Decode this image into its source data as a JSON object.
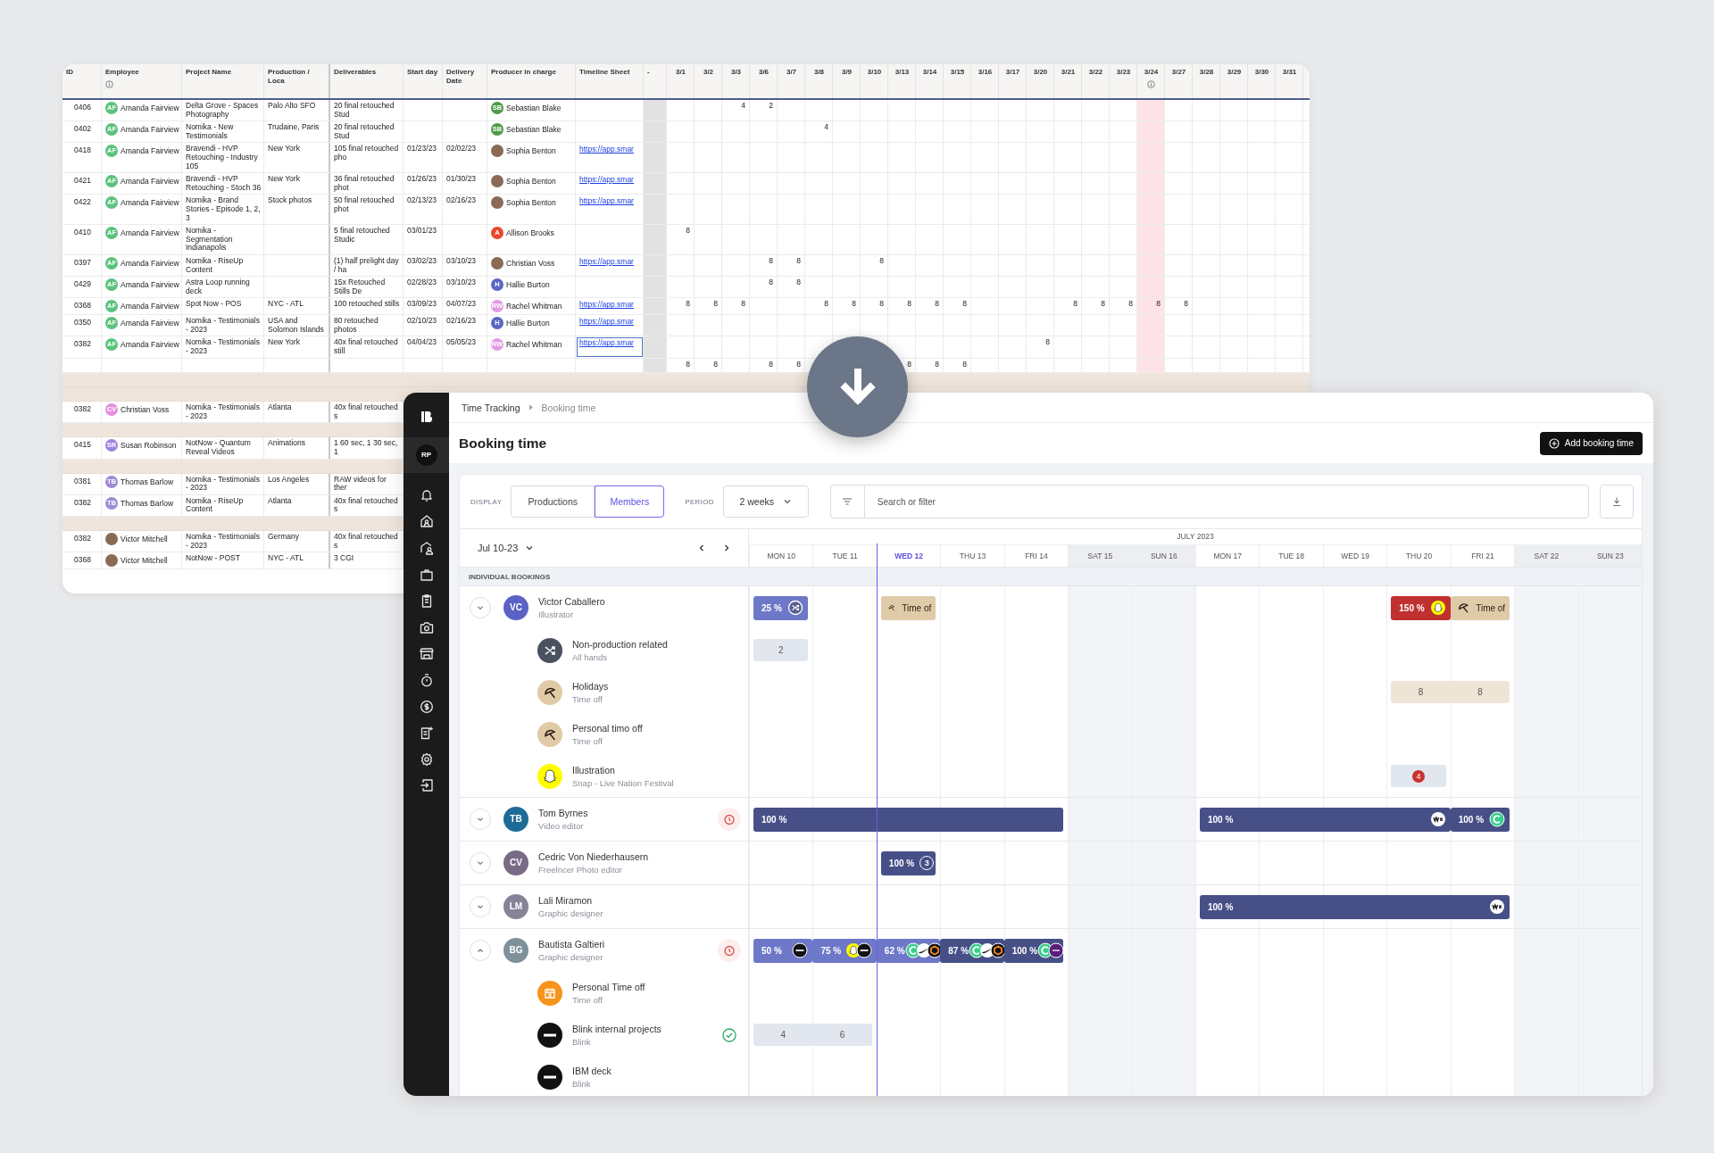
{
  "sheet": {
    "columns": [
      {
        "label": "ID",
        "info": false
      },
      {
        "label": "Employee",
        "info": true
      },
      {
        "label": "Project Name",
        "info": false
      },
      {
        "label": "Production / Loca",
        "info": false
      },
      {
        "label": "Deliverables",
        "info": false
      },
      {
        "label": "Start day",
        "info": false
      },
      {
        "label": "Delivery Date",
        "info": false
      },
      {
        "label": "Producer in charge",
        "info": false
      },
      {
        "label": "Timeline Sheet",
        "info": false
      },
      {
        "label": "-",
        "info": false
      }
    ],
    "days": [
      {
        "label": "3/1",
        "info": false,
        "highlighted": false
      },
      {
        "label": "3/2",
        "info": false,
        "highlighted": false
      },
      {
        "label": "3/3",
        "info": false,
        "highlighted": false
      },
      {
        "label": "3/6",
        "info": false,
        "highlighted": false
      },
      {
        "label": "3/7",
        "info": false,
        "highlighted": false
      },
      {
        "label": "3/8",
        "info": false,
        "highlighted": false
      },
      {
        "label": "3/9",
        "info": false,
        "highlighted": false
      },
      {
        "label": "3/10",
        "info": false,
        "highlighted": false
      },
      {
        "label": "3/13",
        "info": false,
        "highlighted": false
      },
      {
        "label": "3/14",
        "info": false,
        "highlighted": false
      },
      {
        "label": "3/15",
        "info": false,
        "highlighted": false
      },
      {
        "label": "3/16",
        "info": false,
        "highlighted": false
      },
      {
        "label": "3/17",
        "info": false,
        "highlighted": false
      },
      {
        "label": "3/20",
        "info": false,
        "highlighted": false
      },
      {
        "label": "3/21",
        "info": false,
        "highlighted": false
      },
      {
        "label": "3/22",
        "info": false,
        "highlighted": false
      },
      {
        "label": "3/23",
        "info": false,
        "highlighted": false
      },
      {
        "label": "3/24",
        "info": true,
        "highlighted": true
      },
      {
        "label": "3/27",
        "info": false,
        "highlighted": false
      },
      {
        "label": "3/28",
        "info": false,
        "highlighted": false
      },
      {
        "label": "3/29",
        "info": false,
        "highlighted": false
      },
      {
        "label": "3/30",
        "info": false,
        "highlighted": false
      },
      {
        "label": "3/31",
        "info": false,
        "highlighted": false
      }
    ],
    "rows": [
      {
        "kind": "entry",
        "id": "0406",
        "employee": {
          "name": "Amanda Fairview",
          "avatar": {
            "kind": "initials",
            "initials": "AF",
            "color": "#5cc27e"
          }
        },
        "project": "Delta Grove - Spaces Photography",
        "location": "Palo Alto SFO",
        "deliverables": "20 final retouched Stud",
        "producer": {
          "name": "Sebastian Blake",
          "avatar": {
            "kind": "initials",
            "initials": "SB",
            "color": "#4e9a47"
          }
        },
        "selected": false,
        "hours": [
          {
            "kind": "none"
          },
          {
            "kind": "none"
          },
          {
            "kind": "hours",
            "value": "4"
          },
          {
            "kind": "hours",
            "value": "2"
          }
        ]
      },
      {
        "kind": "entry",
        "id": "0402",
        "employee": {
          "name": "Amanda Fairview",
          "avatar": {
            "kind": "initials",
            "initials": "AF",
            "color": "#5cc27e"
          }
        },
        "project": "Nomika - New Testimonials",
        "location": "Trudaine, Paris",
        "deliverables": "20 final retouched Stud",
        "producer": {
          "name": "Sebastian Blake",
          "avatar": {
            "kind": "initials",
            "initials": "SB",
            "color": "#4e9a47"
          }
        },
        "selected": false,
        "hours": [
          {
            "kind": "none"
          },
          {
            "kind": "none"
          },
          {
            "kind": "none"
          },
          {
            "kind": "none"
          },
          {
            "kind": "none"
          },
          {
            "kind": "hours",
            "value": "4"
          }
        ]
      },
      {
        "kind": "entry",
        "id": "0418",
        "employee": {
          "name": "Amanda Fairview",
          "avatar": {
            "kind": "initials",
            "initials": "AF",
            "color": "#5cc27e"
          }
        },
        "project": "Bravendi - HVP Retouching - Industry 105",
        "location": "New York",
        "deliverables": "105 final retouched pho",
        "start": "01/23/23",
        "delivery": "02/02/23",
        "producer": {
          "name": "Sophia Benton",
          "avatar": {
            "kind": "photo"
          }
        },
        "link": "https://app.smar",
        "selected": false
      },
      {
        "kind": "entry",
        "id": "0421",
        "employee": {
          "name": "Amanda Fairview",
          "avatar": {
            "kind": "initials",
            "initials": "AF",
            "color": "#5cc27e"
          }
        },
        "project": "Bravendi - HVP Retouching - Stoch 36",
        "location": "New York",
        "deliverables": "36 final retouched phot",
        "start": "01/26/23",
        "delivery": "01/30/23",
        "producer": {
          "name": "Sophia Benton",
          "avatar": {
            "kind": "photo"
          }
        },
        "link": "https://app.smar",
        "selected": false
      },
      {
        "kind": "entry",
        "id": "0422",
        "employee": {
          "name": "Amanda Fairview",
          "avatar": {
            "kind": "initials",
            "initials": "AF",
            "color": "#5cc27e"
          }
        },
        "project": "Nomika - Brand Stories - Episode 1, 2, 3",
        "location": "Stock photos",
        "deliverables": "50 final retouched phot",
        "start": "02/13/23",
        "delivery": "02/16/23",
        "producer": {
          "name": "Sophia Benton",
          "avatar": {
            "kind": "photo"
          }
        },
        "link": "https://app.smar",
        "selected": false
      },
      {
        "kind": "entry",
        "id": "0410",
        "employee": {
          "name": "Amanda Fairview",
          "avatar": {
            "kind": "initials",
            "initials": "AF",
            "color": "#5cc27e"
          }
        },
        "project": "Nomika - Segmentation Indianapolis",
        "deliverables": "5 final retouched Studic",
        "start": "03/01/23",
        "producer": {
          "name": "Allison Brooks",
          "avatar": {
            "kind": "initials",
            "initials": "A",
            "color": "#e8492d"
          }
        },
        "selected": false,
        "hours": [
          {
            "kind": "hours",
            "value": "8"
          }
        ]
      },
      {
        "kind": "entry",
        "id": "0397",
        "employee": {
          "name": "Amanda Fairview",
          "avatar": {
            "kind": "initials",
            "initials": "AF",
            "color": "#5cc27e"
          }
        },
        "project": "Nomika - RiseUp Content",
        "deliverables": "(1) half prelight day / ha",
        "start": "03/02/23",
        "delivery": "03/10/23",
        "producer": {
          "name": "Christian Voss",
          "avatar": {
            "kind": "photo"
          }
        },
        "link": "https://app.smar",
        "selected": false,
        "hours": [
          {
            "kind": "none"
          },
          {
            "kind": "none"
          },
          {
            "kind": "none"
          },
          {
            "kind": "hours",
            "value": "8"
          },
          {
            "kind": "hours",
            "value": "8"
          },
          {
            "kind": "none"
          },
          {
            "kind": "none"
          },
          {
            "kind": "hours",
            "value": "8"
          }
        ]
      },
      {
        "kind": "entry",
        "id": "0429",
        "employee": {
          "name": "Amanda Fairview",
          "avatar": {
            "kind": "initials",
            "initials": "AF",
            "color": "#5cc27e"
          }
        },
        "project": "Astra Loop running deck",
        "deliverables": "15x Retouched Stills De",
        "start": "02/28/23",
        "delivery": "03/10/23",
        "producer": {
          "name": "Hallie Burton",
          "avatar": {
            "kind": "initials",
            "initials": "H",
            "color": "#5a68c2"
          }
        },
        "selected": false,
        "hours": [
          {
            "kind": "none"
          },
          {
            "kind": "none"
          },
          {
            "kind": "none"
          },
          {
            "kind": "hours",
            "value": "8"
          },
          {
            "kind": "hours",
            "value": "8"
          }
        ]
      },
      {
        "kind": "entry",
        "id": "0368",
        "employee": {
          "name": "Amanda Fairview",
          "avatar": {
            "kind": "initials",
            "initials": "AF",
            "color": "#5cc27e"
          }
        },
        "project": "Spot Now - POS",
        "location": "NYC - ATL",
        "deliverables": "100 retouched stills",
        "start": "03/09/23",
        "delivery": "04/07/23",
        "producer": {
          "name": "Rachel Whitman",
          "avatar": {
            "kind": "initials",
            "initials": "RW",
            "color": "#e39ae3"
          }
        },
        "link": "https://app.smar",
        "selected": false,
        "hours": [
          {
            "kind": "hours",
            "value": "8"
          },
          {
            "kind": "hours",
            "value": "8"
          },
          {
            "kind": "hours",
            "value": "8"
          },
          {
            "kind": "none"
          },
          {
            "kind": "none"
          },
          {
            "kind": "hours",
            "value": "8"
          },
          {
            "kind": "hours",
            "value": "8"
          },
          {
            "kind": "hours",
            "value": "8"
          },
          {
            "kind": "hours",
            "value": "8"
          },
          {
            "kind": "hours",
            "value": "8"
          },
          {
            "kind": "hours",
            "value": "8"
          },
          {
            "kind": "none"
          },
          {
            "kind": "none"
          },
          {
            "kind": "none"
          },
          {
            "kind": "hours",
            "value": "8"
          },
          {
            "kind": "hours",
            "value": "8"
          },
          {
            "kind": "hours",
            "value": "8"
          },
          {
            "kind": "hours",
            "value": "8"
          },
          {
            "kind": "hours",
            "value": "8"
          }
        ]
      },
      {
        "kind": "entry",
        "id": "0350",
        "employee": {
          "name": "Amanda Fairview",
          "avatar": {
            "kind": "initials",
            "initials": "AF",
            "color": "#5cc27e"
          }
        },
        "project": "Nomika - Testimonials - 2023",
        "location": "USA and Solomon Islands",
        "deliverables": "80 retouched photos",
        "start": "02/10/23",
        "delivery": "02/16/23",
        "producer": {
          "name": "Hallie Burton",
          "avatar": {
            "kind": "initials",
            "initials": "H",
            "color": "#5a68c2"
          }
        },
        "link": "https://app.smar",
        "selected": false
      },
      {
        "kind": "entry",
        "id": "0382",
        "employee": {
          "name": "Amanda Fairview",
          "avatar": {
            "kind": "initials",
            "initials": "AF",
            "color": "#5cc27e"
          }
        },
        "project": "Nomika - Testimonials - 2023",
        "location": "New York",
        "deliverables": "40x final retouched still",
        "start": "04/04/23",
        "delivery": "05/05/23",
        "producer": {
          "name": "Rachel Whitman",
          "avatar": {
            "kind": "initials",
            "initials": "RW",
            "color": "#e39ae3"
          }
        },
        "link": "https://app.smar",
        "selected": true,
        "hours": [
          {
            "kind": "none"
          },
          {
            "kind": "none"
          },
          {
            "kind": "none"
          },
          {
            "kind": "none"
          },
          {
            "kind": "none"
          },
          {
            "kind": "none"
          },
          {
            "kind": "none"
          },
          {
            "kind": "none"
          },
          {
            "kind": "none"
          },
          {
            "kind": "none"
          },
          {
            "kind": "none"
          },
          {
            "kind": "none"
          },
          {
            "kind": "none"
          },
          {
            "kind": "hours",
            "value": "8"
          }
        ]
      },
      {
        "kind": "entry",
        "selected": false,
        "hours": [
          {
            "kind": "hours",
            "value": "8"
          },
          {
            "kind": "hours",
            "value": "8"
          },
          {
            "kind": "none"
          },
          {
            "kind": "hours",
            "value": "8"
          },
          {
            "kind": "hours",
            "value": "8"
          },
          {
            "kind": "none"
          },
          {
            "kind": "none"
          },
          {
            "kind": "none"
          },
          {
            "kind": "hours",
            "value": "8"
          },
          {
            "kind": "hours",
            "value": "8"
          },
          {
            "kind": "hours",
            "value": "8"
          }
        ]
      },
      {
        "kind": "band"
      },
      {
        "kind": "band"
      },
      {
        "kind": "entry",
        "id": "0382",
        "employee": {
          "name": "Christian Voss",
          "avatar": {
            "kind": "initials",
            "initials": "CV",
            "color": "#e58fe0"
          }
        },
        "project": "Nomika - Testimonials - 2023",
        "location": "Atlanta",
        "deliverables": "40x final retouched s",
        "selected": false
      },
      {
        "kind": "band"
      },
      {
        "kind": "entry",
        "id": "0415",
        "employee": {
          "name": "Susan Robinson",
          "avatar": {
            "kind": "initials",
            "initials": "SR",
            "color": "#9d86dc"
          }
        },
        "project": "NotNow - Quantum Reveal Videos",
        "location": "Animations",
        "deliverables": "1 60 sec, 1 30 sec, 1",
        "selected": false
      },
      {
        "kind": "band"
      },
      {
        "kind": "entry",
        "id": "0381",
        "employee": {
          "name": "Thomas Barlow",
          "avatar": {
            "kind": "initials",
            "initials": "TB",
            "color": "#9f8ad8"
          }
        },
        "project": "Nomika - Testimonials - 2023",
        "location": "Los Angeles",
        "deliverables": "RAW videos for ther",
        "selected": false
      },
      {
        "kind": "entry",
        "id": "0382",
        "employee": {
          "name": "Thomas Barlow",
          "avatar": {
            "kind": "initials",
            "initials": "TB",
            "color": "#9f8ad8"
          }
        },
        "project": "Nomika - RiseUp Content",
        "location": "Atlanta",
        "deliverables": "40x final retouched s",
        "selected": false
      },
      {
        "kind": "band"
      },
      {
        "kind": "entry",
        "id": "0382",
        "employee": {
          "name": "Victor Mitchell",
          "avatar": {
            "kind": "photo"
          }
        },
        "project": "Nomika - Testimonials - 2023",
        "location": "Germany",
        "deliverables": "40x final retouched s",
        "selected": false
      },
      {
        "kind": "entry",
        "id": "0368",
        "employee": {
          "name": "Victor Mitchell",
          "avatar": {
            "kind": "photo"
          }
        },
        "project": "NotNow - POST",
        "location": "NYC - ATL",
        "deliverables": "3 CGI",
        "selected": false
      }
    ]
  },
  "app": {
    "avatar": "RP",
    "breadcrumb": [
      "Time Tracking",
      "Booking time"
    ],
    "title": "Booking time",
    "add_button": "Add booking time",
    "display_label": "DISPLAY",
    "views": [
      {
        "label": "Productions",
        "selected": false
      },
      {
        "label": "Members",
        "selected": true
      }
    ],
    "period_label": "PERIOD",
    "period": "2 weeks",
    "search": {
      "placeholder": "Search or filter"
    },
    "range": "Jul 10-23",
    "month": "JULY 2023",
    "days": [
      {
        "label": "MON 10",
        "weekend": false,
        "today": false
      },
      {
        "label": "TUE 11",
        "weekend": false,
        "today": false
      },
      {
        "label": "WED 12",
        "weekend": false,
        "today": true
      },
      {
        "label": "THU 13",
        "weekend": false,
        "today": false
      },
      {
        "label": "FRI 14",
        "weekend": false,
        "today": false
      },
      {
        "label": "SAT 15",
        "weekend": true,
        "today": false
      },
      {
        "label": "SUN 16",
        "weekend": true,
        "today": false
      },
      {
        "label": "MON 17",
        "weekend": false,
        "today": false
      },
      {
        "label": "TUE 18",
        "weekend": false,
        "today": false
      },
      {
        "label": "WED 19",
        "weekend": false,
        "today": false
      },
      {
        "label": "THU 20",
        "weekend": false,
        "today": false
      },
      {
        "label": "FRI 21",
        "weekend": false,
        "today": false
      },
      {
        "label": "SAT 22",
        "weekend": true,
        "today": false
      },
      {
        "label": "SUN 23",
        "weekend": true,
        "today": false
      }
    ],
    "section": "INDIVIDUAL BOOKINGS",
    "people": [
      {
        "initials": "VC",
        "color": "#5c62c4",
        "name": "Victor Caballero",
        "role": "Illustrator",
        "expanded": false,
        "alert": false,
        "cells": [
          {
            "kind": "partial",
            "label": "25 %",
            "badges": [
              {
                "kind": "shuffle"
              }
            ]
          },
          {
            "kind": "none"
          },
          {
            "kind": "timeoff",
            "label": "Time of"
          },
          {
            "kind": "none"
          },
          {
            "kind": "none"
          },
          {
            "kind": "none"
          },
          {
            "kind": "none"
          },
          {
            "kind": "none"
          },
          {
            "kind": "none"
          },
          {
            "kind": "none"
          },
          {
            "kind": "over",
            "label": "150 %",
            "badges": [
              {
                "kind": "snap"
              }
            ]
          },
          {
            "kind": "timeoff",
            "label": "Time of"
          }
        ],
        "children": [
          {
            "kind": "shuffle",
            "title": "Non-production related",
            "subtitle": "All hands",
            "done": false,
            "cells": [
              {
                "kind": "grey",
                "value": "2"
              }
            ]
          },
          {
            "kind": "umbrella",
            "title": "Holidays",
            "subtitle": "Time off",
            "done": false,
            "cells": [
              {
                "kind": "none"
              },
              {
                "kind": "none"
              },
              {
                "kind": "none"
              },
              {
                "kind": "none"
              },
              {
                "kind": "none"
              },
              {
                "kind": "none"
              },
              {
                "kind": "none"
              },
              {
                "kind": "none"
              },
              {
                "kind": "none"
              },
              {
                "kind": "none"
              },
              {
                "kind": "beige",
                "value": "8"
              },
              {
                "kind": "cont",
                "value": "8"
              }
            ]
          },
          {
            "kind": "umbrella",
            "title": "Personal timo off",
            "subtitle": "Time off",
            "done": false
          },
          {
            "kind": "snap",
            "title": "Illustration",
            "subtitle": "Snap - Live Nation Festival",
            "done": false,
            "cells": [
              {
                "kind": "none"
              },
              {
                "kind": "none"
              },
              {
                "kind": "none"
              },
              {
                "kind": "none"
              },
              {
                "kind": "none"
              },
              {
                "kind": "none"
              },
              {
                "kind": "none"
              },
              {
                "kind": "none"
              },
              {
                "kind": "none"
              },
              {
                "kind": "none"
              },
              {
                "kind": "grey",
                "alert": "4"
              }
            ]
          }
        ]
      },
      {
        "initials": "TB",
        "color": "#1f6b97",
        "name": "Tom Byrnes",
        "role": "Video editor",
        "expanded": false,
        "alert": true,
        "cells": [
          {
            "kind": "full",
            "label": "100 %"
          },
          {
            "kind": "cont"
          },
          {
            "kind": "cont"
          },
          {
            "kind": "cont"
          },
          {
            "kind": "cont"
          },
          {
            "kind": "none"
          },
          {
            "kind": "none"
          },
          {
            "kind": "full",
            "label": "100 %",
            "badges": [
              {
                "kind": "we"
              }
            ]
          },
          {
            "kind": "cont"
          },
          {
            "kind": "cont"
          },
          {
            "kind": "cont"
          },
          {
            "kind": "full",
            "label": "100 %",
            "badges": [
              {
                "kind": "c"
              }
            ]
          }
        ]
      },
      {
        "initials": "CV",
        "color": "#776b86",
        "name": "Cedric Von Niederhausern",
        "role": "Freelncer Photo editor",
        "expanded": false,
        "alert": false,
        "cells": [
          {
            "kind": "none"
          },
          {
            "kind": "none"
          },
          {
            "kind": "full",
            "label": "100 %",
            "count": "3"
          }
        ]
      },
      {
        "initials": "LM",
        "color": "#878297",
        "name": "Lali Miramon",
        "role": "Graphic designer",
        "expanded": false,
        "alert": false,
        "cells": [
          {
            "kind": "none"
          },
          {
            "kind": "none"
          },
          {
            "kind": "none"
          },
          {
            "kind": "none"
          },
          {
            "kind": "none"
          },
          {
            "kind": "none"
          },
          {
            "kind": "none"
          },
          {
            "kind": "full",
            "label": "100 %",
            "badges": [
              {
                "kind": "we"
              }
            ]
          },
          {
            "kind": "cont"
          },
          {
            "kind": "cont"
          },
          {
            "kind": "cont"
          },
          {
            "kind": "cont"
          }
        ]
      },
      {
        "initials": "BG",
        "color": "#7e909a",
        "name": "Bautista Galtieri",
        "role": "Graphic designer",
        "expanded": true,
        "alert": true,
        "cells": [
          {
            "kind": "partial",
            "label": "50 %",
            "badges": [
              {
                "kind": "blink"
              }
            ]
          },
          {
            "kind": "partial",
            "label": "75 %",
            "badges": [
              {
                "kind": "snap"
              },
              {
                "kind": "blink"
              }
            ]
          },
          {
            "kind": "partial",
            "label": "62 %",
            "badges": [
              {
                "kind": "c"
              },
              {
                "kind": "nike"
              },
              {
                "kind": "hex"
              }
            ]
          },
          {
            "kind": "full",
            "label": "87 %",
            "badges": [
              {
                "kind": "c"
              },
              {
                "kind": "nike"
              },
              {
                "kind": "hex"
              }
            ]
          },
          {
            "kind": "full",
            "label": "100 %",
            "badges": [
              {
                "kind": "c"
              },
              {
                "kind": "hbo"
              }
            ]
          }
        ],
        "children": [
          {
            "kind": "calendar",
            "title": "Personal Time off",
            "subtitle": "Time off",
            "done": false
          },
          {
            "kind": "blink",
            "title": "Blink internal projects",
            "subtitle": "Blink",
            "done": true,
            "cells": [
              {
                "kind": "grey",
                "value": "4"
              },
              {
                "kind": "cont",
                "value": "6"
              }
            ]
          },
          {
            "kind": "blink",
            "title": "IBM deck",
            "subtitle": "Blink",
            "done": false
          }
        ]
      }
    ]
  }
}
